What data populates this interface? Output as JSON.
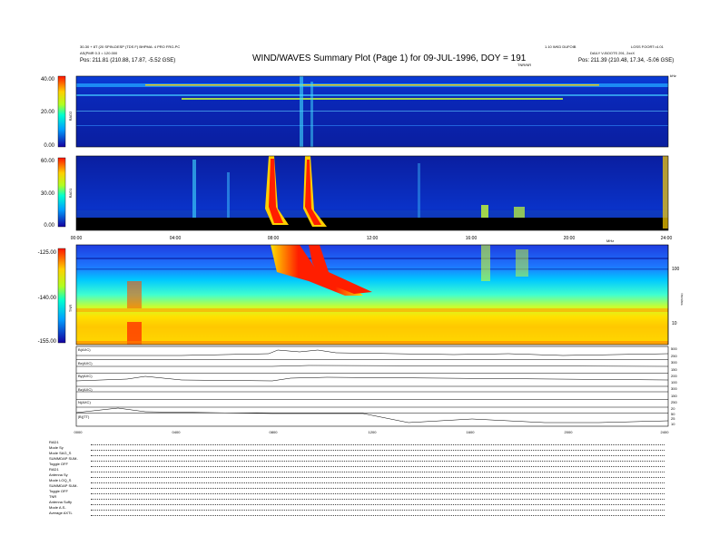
{
  "header": {
    "title": "WIND/WAVES Summary Plot (Page 1) for 09-JUL-1996, DOY = 191",
    "left_line1": "30-30 + 8T (20 SPIN-DESP (TDS F) BHPMA: 4 PRO FRG-PC",
    "left_line2": "AS(PMR 0.3 = 120.000",
    "left_pos": "Pos:   211.81 (210.88, 17.87, -5.52 GSE)",
    "right_line1": "1.10 WKD  DUFOIB",
    "right_line2": "LOSS FOORT=4.01",
    "right_line3": "DAILY  V-BOOTS 291, 2xxX",
    "right_pos": "Pos:   211.39 (210.48, 17.34, -5.06 GSE)",
    "tnr_label_top": "TNR/NR",
    "unit_top_right": "kHz",
    "unit_mid_right": "MHz"
  },
  "colors": {
    "frame": "#000000",
    "background_field": "#0a1ea0",
    "burst": "#ff1e00"
  },
  "chart_data": [
    {
      "type": "heatmap",
      "name": "RAD2",
      "panel_label": "RAD2",
      "colorbar_ticks": [
        "40.00",
        "20.00",
        "0.00"
      ],
      "colorbar_range": [
        0,
        40
      ]
    },
    {
      "type": "heatmap",
      "name": "RAD1",
      "panel_label": "RAD1",
      "colorbar_ticks": [
        "60.00",
        "30.00",
        "0.00"
      ],
      "colorbar_range": [
        0,
        60
      ],
      "time_ticks": [
        "00:00",
        "04:00",
        "08:00",
        "12:00",
        "16:00",
        "20:00",
        "24:00"
      ]
    },
    {
      "type": "heatmap",
      "name": "TNR",
      "panel_label": "TNR",
      "colorbar_ticks": [
        "-125.00",
        "-140.00",
        "-155.00"
      ],
      "colorbar_range": [
        -155,
        -125
      ],
      "freq_ticks": [
        "100",
        "10"
      ],
      "axis_label_right": "SW(GSE)"
    },
    {
      "type": "line",
      "series_labels": [
        "B(AXC)",
        "Bx(AXC)",
        "By(AXC)",
        "Bz(AXC)",
        "N(AXC)",
        "|B|(TT)"
      ],
      "right_ticks": [
        [
          "500",
          "250"
        ],
        [
          "300",
          "150"
        ],
        [
          "200",
          "100"
        ],
        [
          "300",
          "150"
        ],
        [
          "250",
          "20"
        ],
        [
          "50",
          "25",
          "10"
        ]
      ],
      "time_ticks": [
        "0000",
        "0400",
        "0800",
        "1200",
        "1600",
        "2000",
        "2400"
      ]
    }
  ],
  "footer": {
    "rows": [
      "RAD1",
      "Mode   Sy",
      "Mode   SAG_S",
      "SUMMDAP  SUM-",
      "Toggle   OFF",
      "RAD1",
      "Antenna   Sy",
      "Mode   LOQ_S",
      "SUMMDAP  SUM-",
      "Toggle   OFF",
      "TNR",
      "Antenna  Suffy",
      "Mode   A.S-",
      "Average   AXTL"
    ]
  }
}
